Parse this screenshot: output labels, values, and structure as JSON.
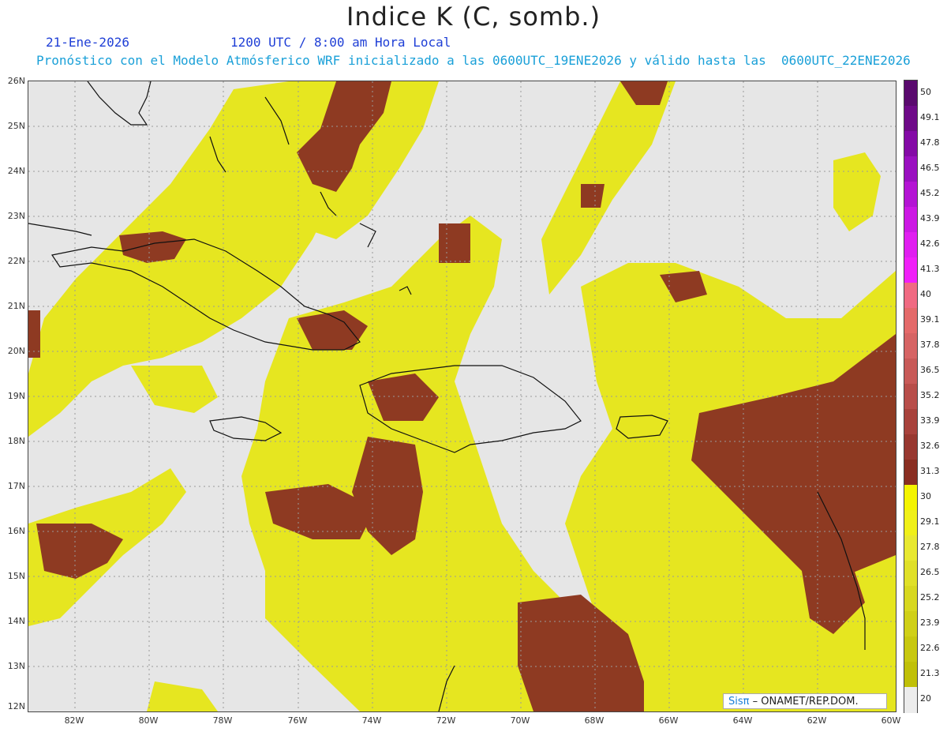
{
  "header": {
    "title": "Indice K (C, somb.)",
    "date": "21-Ene-2026",
    "time": "1200 UTC / 8:00 am Hora Local",
    "description": "Pronóstico con el Modelo Atmósferico WRF inicializado a las 0600UTC_19ENE2026 y válido hasta las  0600UTC_22ENE2026"
  },
  "map": {
    "lat_labels": [
      "26N",
      "25N",
      "24N",
      "23N",
      "22N",
      "21N",
      "20N",
      "19N",
      "18N",
      "17N",
      "16N",
      "15N",
      "14N",
      "13N",
      "12N"
    ],
    "lon_labels": [
      "82W",
      "80W",
      "78W",
      "76W",
      "74W",
      "72W",
      "70W",
      "68W",
      "66W",
      "64W",
      "62W",
      "60W"
    ],
    "extent": {
      "lon_min": -83.2,
      "lon_max": -60,
      "lat_min": 12,
      "lat_max": 26.1
    }
  },
  "colorbar": {
    "labels": [
      "50",
      "49.1",
      "47.8",
      "46.5",
      "45.2",
      "43.9",
      "42.6",
      "41.3",
      "40",
      "39.1",
      "37.8",
      "36.5",
      "35.2",
      "33.9",
      "32.6",
      "31.3",
      "30",
      "29.1",
      "27.8",
      "26.5",
      "25.2",
      "23.9",
      "22.6",
      "21.3",
      "20"
    ],
    "colors": [
      "#5a0a6e",
      "#6e0a88",
      "#840aa6",
      "#9a10c0",
      "#b414d4",
      "#cc18e4",
      "#e01ef0",
      "#f020f8",
      "#f06a82",
      "#e46a6a",
      "#d66464",
      "#c85a58",
      "#b84e4a",
      "#a8423c",
      "#983830",
      "#8a2e22",
      "#f4f400",
      "#f0f018",
      "#e8e830",
      "#e0e028",
      "#d8d820",
      "#d0d018",
      "#c8c810",
      "#c0c008",
      "#ececec"
    ]
  },
  "footer": {
    "credit_sis": "Sisπ",
    "credit_org": " – ONAMET/REP.DOM."
  }
}
